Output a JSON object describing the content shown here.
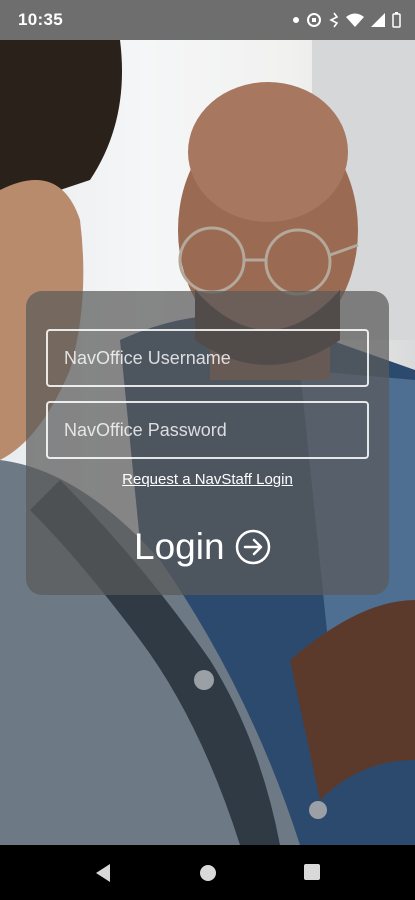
{
  "status_bar": {
    "time": "10:35",
    "icons": [
      "dot-icon",
      "data-saver-icon",
      "vibrate-icon",
      "wifi-icon",
      "signal-icon",
      "battery-icon"
    ]
  },
  "login_form": {
    "username_placeholder": "NavOffice Username",
    "password_placeholder": "NavOffice Password",
    "request_link": "Request a NavStaff Login",
    "login_label": "Login",
    "login_icon": "arrow-right-circle-icon"
  },
  "nav_bar": {
    "buttons": [
      "back-icon",
      "home-icon",
      "recents-icon"
    ]
  },
  "colors": {
    "status_bar_bg": "#6e6e6e",
    "card_bg": "rgba(90,90,90,0.72)",
    "text": "#ffffff"
  }
}
